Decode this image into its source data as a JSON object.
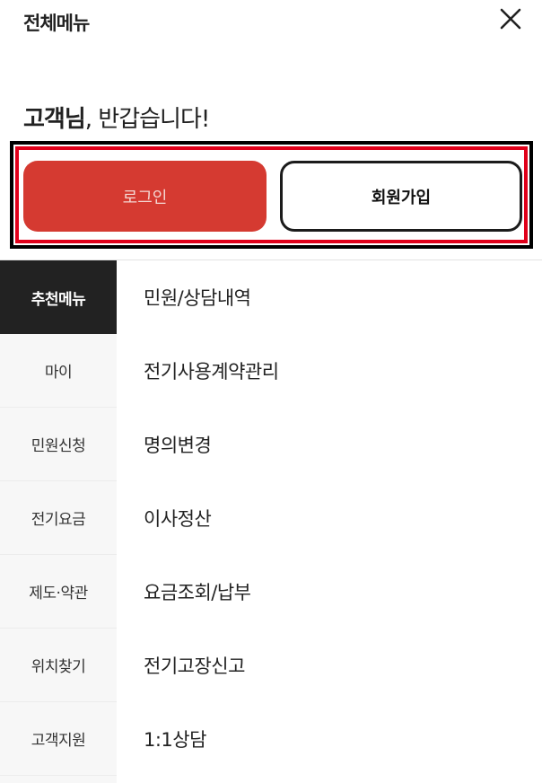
{
  "header": {
    "title": "전체메뉴",
    "close_icon": "close-icon"
  },
  "greeting": {
    "name": "고객님",
    "message": ", 반갑습니다!"
  },
  "auth": {
    "login_label": "로그인",
    "signup_label": "회원가입"
  },
  "colors": {
    "login_bg": "#d53a31",
    "active_tab_bg": "#222222",
    "highlight_border": "#e0001a"
  },
  "side_nav": {
    "items": [
      {
        "label": "추천메뉴",
        "active": true
      },
      {
        "label": "마이"
      },
      {
        "label": "민원신청"
      },
      {
        "label": "전기요금"
      },
      {
        "label": "제도·약관"
      },
      {
        "label": "위치찾기"
      },
      {
        "label": "고객지원"
      }
    ]
  },
  "menu": {
    "items": [
      {
        "label": "민원/상담내역"
      },
      {
        "label": "전기사용계약관리"
      },
      {
        "label": "명의변경"
      },
      {
        "label": "이사정산"
      },
      {
        "label": "요금조회/납부"
      },
      {
        "label": "전기고장신고"
      },
      {
        "label": "1:1상담"
      }
    ]
  }
}
